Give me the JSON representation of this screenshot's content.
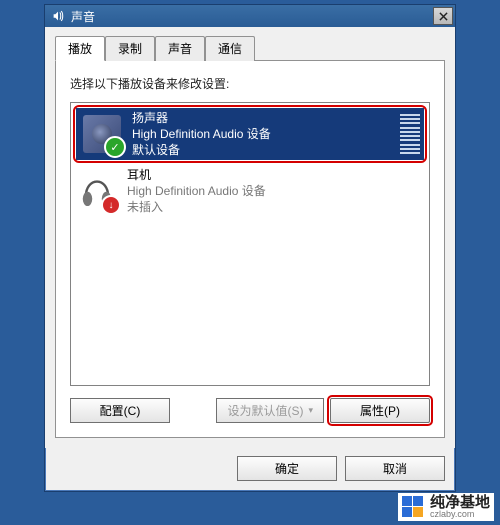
{
  "window": {
    "title": "声音"
  },
  "tabs": [
    "播放",
    "录制",
    "声音",
    "通信"
  ],
  "active_tab": 0,
  "panel": {
    "instruction": "选择以下播放设备来修改设置:",
    "devices": [
      {
        "name": "扬声器",
        "subname": "High Definition Audio 设备",
        "status": "默认设备",
        "icon": "speaker-icon",
        "badge": "check",
        "selected": true,
        "highlighted": true
      },
      {
        "name": "耳机",
        "subname": "High Definition Audio 设备",
        "status": "未插入",
        "icon": "headphone-icon",
        "badge": "unplugged",
        "selected": false,
        "highlighted": false
      }
    ],
    "buttons": {
      "configure": "配置(C)",
      "set_default": "设为默认值(S)",
      "properties": "属性(P)"
    }
  },
  "dialog_buttons": {
    "ok": "确定",
    "cancel": "取消"
  },
  "watermark": {
    "cn": "纯净基地",
    "en": "czlaby.com"
  }
}
